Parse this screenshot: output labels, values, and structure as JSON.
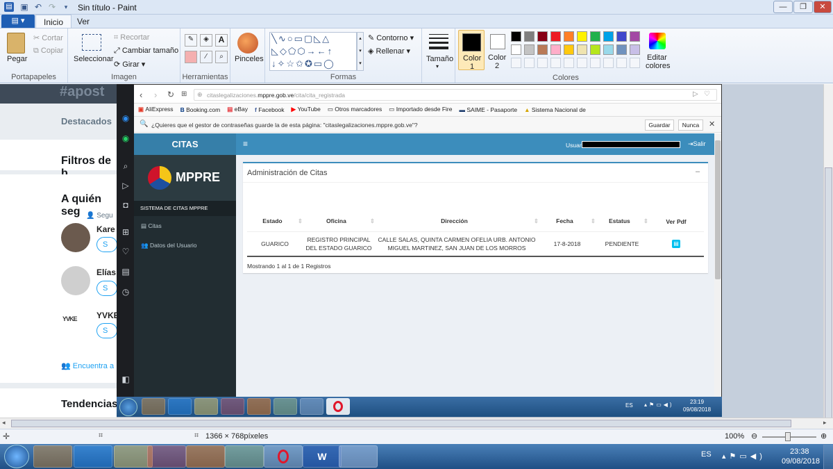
{
  "paint": {
    "title": "Sin título - Paint",
    "tabs": [
      "Inicio",
      "Ver"
    ],
    "groups": {
      "portapapeles": {
        "label": "Portapapeles",
        "pegar": "Pegar",
        "cortar": "Cortar",
        "copiar": "Copiar"
      },
      "imagen": {
        "label": "Imagen",
        "seleccionar": "Seleccionar",
        "recortar": "Recortar",
        "cambiar_tamano": "Cambiar tamaño",
        "girar": "Girar"
      },
      "herramientas": {
        "label": "Herramientas"
      },
      "pinceles": {
        "label": "Pinceles"
      },
      "formas": {
        "label": "Formas",
        "contorno": "Contorno",
        "rellenar": "Rellenar"
      },
      "tamano": {
        "label": "Tamaño"
      },
      "color1": {
        "label": "Color",
        "num": "1"
      },
      "color2": {
        "label": "Color",
        "num": "2"
      },
      "colores": {
        "label": "Colores",
        "editar": "Editar",
        "editar2": "colores"
      }
    },
    "palette_row1": [
      "#000000",
      "#7f7f7f",
      "#880015",
      "#ed1c24",
      "#ff7f27",
      "#fff200",
      "#22b14c",
      "#00a2e8",
      "#3f48cc",
      "#a349a4"
    ],
    "palette_row2": [
      "#ffffff",
      "#c3c3c3",
      "#b97a57",
      "#ffaec9",
      "#ffc90e",
      "#efe4b0",
      "#b5e61d",
      "#99d9ea",
      "#7092be",
      "#c8bfe7"
    ],
    "status": {
      "dimensions": "1366 × 768píxeles",
      "zoom": "100%"
    }
  },
  "twitter_bg": {
    "hashtag": "#apost",
    "destacados": "Destacados",
    "filtros": "Filtros de b",
    "quien": "A quién seg",
    "seguir_small": "Segu",
    "user1": "Kare",
    "user2": "Elías",
    "user3": "YVKE",
    "follow": "S",
    "encuentra": "Encuentra a",
    "tendencias": "Tendencias"
  },
  "browser": {
    "url_prefix": "citaslegalizaciones.",
    "url_domain": "mppre.gob.ve",
    "url_path": "/cita/cita_registrada",
    "bookmarks": [
      "AliExpress",
      "Booking.com",
      "eBay",
      "Facebook",
      "YouTube",
      "Otros marcadores",
      "Importado desde Fire",
      "SAIME - Pasaporte",
      "Sistema Nacional de"
    ],
    "password_prompt": "¿Quieres que el gestor de contraseñas guarde la de esta página: \"citaslegalizaciones.mppre.gob.ve\"?",
    "guardar": "Guardar",
    "nunca": "Nunca"
  },
  "app": {
    "brand": "CITAS",
    "logo_text": "MPPRE",
    "usuario_label": "Usuario",
    "salir": "Salir",
    "sidebar_header": "SISTEMA DE CITAS MPPRE",
    "menu": [
      "Citas",
      "Datos del Usuario"
    ],
    "box_title": "Administración de Citas",
    "columns": [
      "Estado",
      "Oficina",
      "Dirección",
      "Fecha",
      "Estatus",
      "Ver Pdf"
    ],
    "rows": [
      {
        "estado": "GUARICO",
        "oficina_l1": "REGISTRO PRINCIPAL",
        "oficina_l2": "DEL ESTADO GUARICO",
        "direccion_l1": "CALLE SALAS, QUINTA CARMEN OFELIA URB. ANTONIO",
        "direccion_l2": "MIGUEL MARTINEZ, SAN JUAN DE LOS MORROS",
        "fecha": "17-8-2018",
        "estatus": "PENDIENTE"
      }
    ],
    "footer": "Mostrando 1 al 1 de 1 Registros"
  },
  "inner_taskbar": {
    "lang": "ES",
    "time": "23:19",
    "date": "09/08/2018"
  },
  "taskbar": {
    "lang": "ES",
    "time": "23:38",
    "date": "09/08/2018"
  },
  "colors": {
    "accent": "#3c8dbc",
    "sidebar": "#222d32",
    "taskbar": "#1f4f85"
  }
}
